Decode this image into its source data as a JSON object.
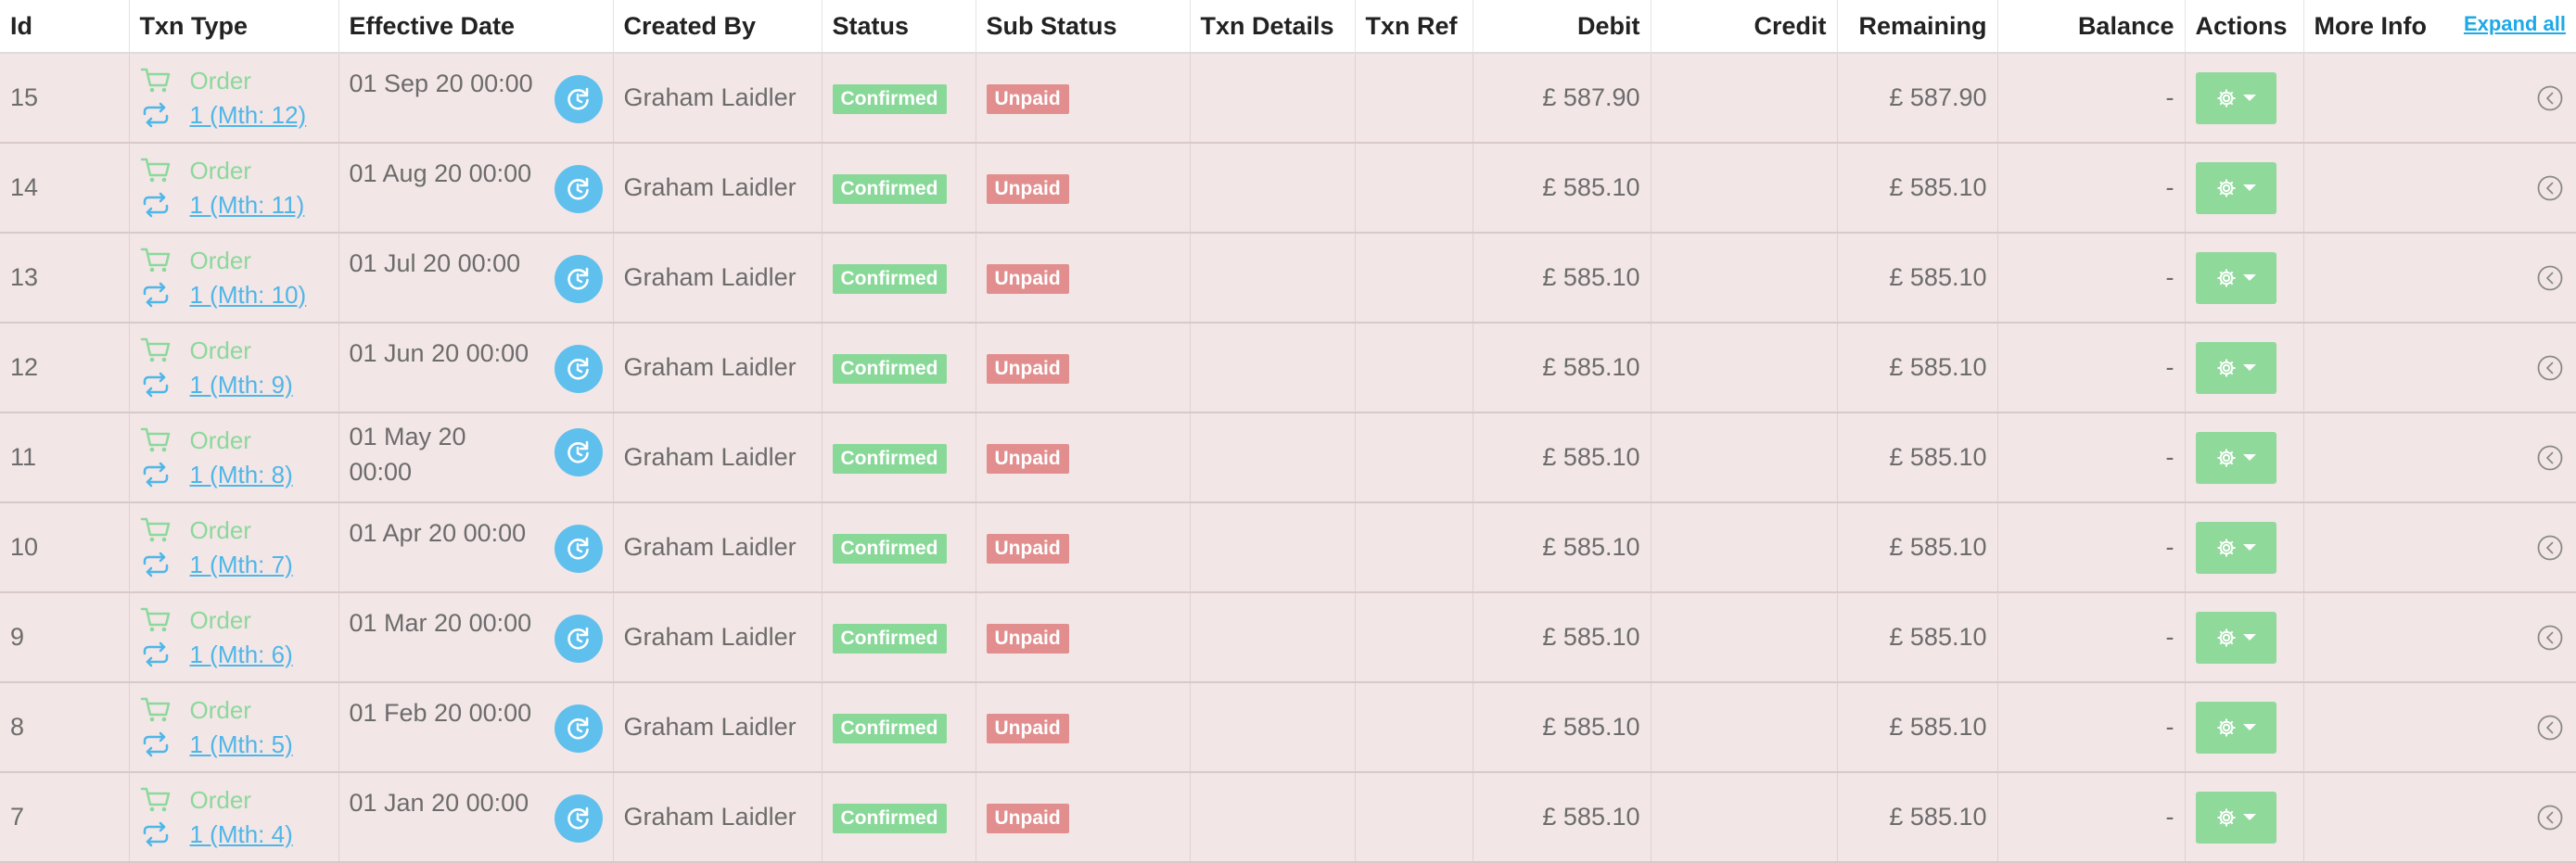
{
  "table": {
    "headers": {
      "id": "Id",
      "txn_type": "Txn Type",
      "effective_date": "Effective Date",
      "created_by": "Created By",
      "status": "Status",
      "sub_status": "Sub Status",
      "txn_details": "Txn Details",
      "txn_ref": "Txn Ref",
      "debit": "Debit",
      "credit": "Credit",
      "remaining": "Remaining",
      "balance": "Balance",
      "actions": "Actions",
      "more_info": "More Info",
      "expand_all": "Expand all"
    },
    "colors": {
      "row_background": "#f3e6e6",
      "confirmed_badge": "#88d898",
      "unpaid_badge": "#e28e8e",
      "action_button": "#8fd99b",
      "clock_button": "#5fc0ee",
      "link": "#4fb6e8"
    },
    "icons": {
      "type": "cart-icon",
      "recurring": "repeat-icon",
      "date_action": "clock-refresh-icon",
      "actions": "gear-icon",
      "more_info": "chevron-circle-left-icon"
    },
    "rows": [
      {
        "id": "15",
        "type": "Order",
        "period": "1 (Mth: 12)",
        "date": "01 Sep 20 00:00",
        "created_by": "Graham Laidler",
        "status": "Confirmed",
        "sub_status": "Unpaid",
        "txn_details": "",
        "txn_ref": "",
        "debit": "£ 587.90",
        "credit": "",
        "remaining": "£ 587.90",
        "balance": "-"
      },
      {
        "id": "14",
        "type": "Order",
        "period": "1 (Mth: 11)",
        "date": "01 Aug 20 00:00",
        "created_by": "Graham Laidler",
        "status": "Confirmed",
        "sub_status": "Unpaid",
        "txn_details": "",
        "txn_ref": "",
        "debit": "£ 585.10",
        "credit": "",
        "remaining": "£ 585.10",
        "balance": "-"
      },
      {
        "id": "13",
        "type": "Order",
        "period": "1 (Mth: 10)",
        "date": "01 Jul 20 00:00",
        "created_by": "Graham Laidler",
        "status": "Confirmed",
        "sub_status": "Unpaid",
        "txn_details": "",
        "txn_ref": "",
        "debit": "£ 585.10",
        "credit": "",
        "remaining": "£ 585.10",
        "balance": "-"
      },
      {
        "id": "12",
        "type": "Order",
        "period": "1 (Mth: 9)",
        "date": "01 Jun 20 00:00",
        "created_by": "Graham Laidler",
        "status": "Confirmed",
        "sub_status": "Unpaid",
        "txn_details": "",
        "txn_ref": "",
        "debit": "£ 585.10",
        "credit": "",
        "remaining": "£ 585.10",
        "balance": "-"
      },
      {
        "id": "11",
        "type": "Order",
        "period": "1 (Mth: 8)",
        "date": "01 May 20 00:00",
        "created_by": "Graham Laidler",
        "status": "Confirmed",
        "sub_status": "Unpaid",
        "txn_details": "",
        "txn_ref": "",
        "debit": "£ 585.10",
        "credit": "",
        "remaining": "£ 585.10",
        "balance": "-"
      },
      {
        "id": "10",
        "type": "Order",
        "period": "1 (Mth: 7)",
        "date": "01 Apr 20 00:00",
        "created_by": "Graham Laidler",
        "status": "Confirmed",
        "sub_status": "Unpaid",
        "txn_details": "",
        "txn_ref": "",
        "debit": "£ 585.10",
        "credit": "",
        "remaining": "£ 585.10",
        "balance": "-"
      },
      {
        "id": "9",
        "type": "Order",
        "period": "1 (Mth: 6)",
        "date": "01 Mar 20 00:00",
        "created_by": "Graham Laidler",
        "status": "Confirmed",
        "sub_status": "Unpaid",
        "txn_details": "",
        "txn_ref": "",
        "debit": "£ 585.10",
        "credit": "",
        "remaining": "£ 585.10",
        "balance": "-"
      },
      {
        "id": "8",
        "type": "Order",
        "period": "1 (Mth: 5)",
        "date": "01 Feb 20 00:00",
        "created_by": "Graham Laidler",
        "status": "Confirmed",
        "sub_status": "Unpaid",
        "txn_details": "",
        "txn_ref": "",
        "debit": "£ 585.10",
        "credit": "",
        "remaining": "£ 585.10",
        "balance": "-"
      },
      {
        "id": "7",
        "type": "Order",
        "period": "1 (Mth: 4)",
        "date": "01 Jan 20 00:00",
        "created_by": "Graham Laidler",
        "status": "Confirmed",
        "sub_status": "Unpaid",
        "txn_details": "",
        "txn_ref": "",
        "debit": "£ 585.10",
        "credit": "",
        "remaining": "£ 585.10",
        "balance": "-"
      }
    ]
  }
}
